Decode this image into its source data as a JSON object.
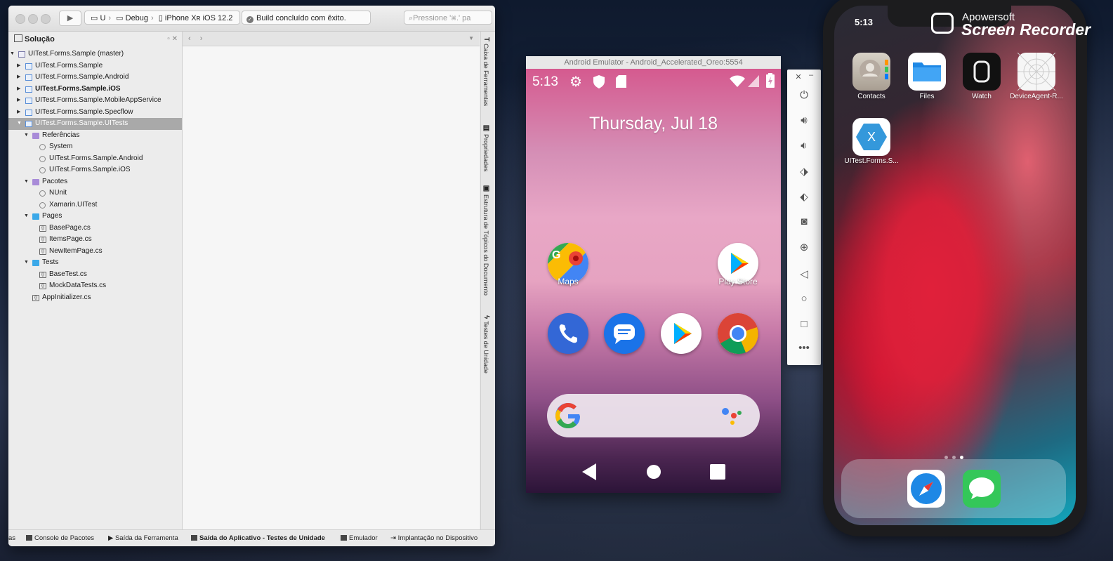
{
  "ide": {
    "scheme": {
      "project": "U",
      "config": "Debug",
      "device": "iPhone Xʀ iOS 12.2"
    },
    "build_status": "Build concluído com êxito.",
    "search_placeholder": "Pressione '⌘.' pa",
    "solution_title": "Solução",
    "tree": [
      {
        "label": "UITest.Forms.Sample (master)",
        "depth": 0,
        "icon": "sol",
        "arrow": "open"
      },
      {
        "label": "UITest.Forms.Sample",
        "depth": 1,
        "icon": "proj",
        "arrow": "closed"
      },
      {
        "label": "UITest.Forms.Sample.Android",
        "depth": 1,
        "icon": "proj",
        "arrow": "closed"
      },
      {
        "label": "UITest.Forms.Sample.iOS",
        "depth": 1,
        "icon": "proj",
        "arrow": "closed",
        "bold": true
      },
      {
        "label": "UITest.Forms.Sample.MobileAppService",
        "depth": 1,
        "icon": "proj",
        "arrow": "closed"
      },
      {
        "label": "UITest.Forms.Sample.Specflow",
        "depth": 1,
        "icon": "proj",
        "arrow": "closed"
      },
      {
        "label": "UITest.Forms.Sample.UITests",
        "depth": 1,
        "icon": "proj",
        "arrow": "open",
        "selected": true
      },
      {
        "label": "Referências",
        "depth": 2,
        "icon": "refs",
        "arrow": "open"
      },
      {
        "label": "System",
        "depth": 3,
        "icon": "ref"
      },
      {
        "label": "UITest.Forms.Sample.Android",
        "depth": 3,
        "icon": "ref"
      },
      {
        "label": "UITest.Forms.Sample.iOS",
        "depth": 3,
        "icon": "ref"
      },
      {
        "label": "Pacotes",
        "depth": 2,
        "icon": "refs",
        "arrow": "open"
      },
      {
        "label": "NUnit",
        "depth": 3,
        "icon": "ref"
      },
      {
        "label": "Xamarin.UITest",
        "depth": 3,
        "icon": "ref"
      },
      {
        "label": "Pages",
        "depth": 2,
        "icon": "folder",
        "arrow": "open"
      },
      {
        "label": "BasePage.cs",
        "depth": 3,
        "icon": "cs"
      },
      {
        "label": "ItemsPage.cs",
        "depth": 3,
        "icon": "cs"
      },
      {
        "label": "NewItemPage.cs",
        "depth": 3,
        "icon": "cs"
      },
      {
        "label": "Tests",
        "depth": 2,
        "icon": "folder",
        "arrow": "open"
      },
      {
        "label": "BaseTest.cs",
        "depth": 3,
        "icon": "cs"
      },
      {
        "label": "MockDataTests.cs",
        "depth": 3,
        "icon": "cs"
      },
      {
        "label": "AppInitializer.cs",
        "depth": 2,
        "icon": "cs"
      }
    ],
    "right_tabs": [
      "Caixa de Ferramentas",
      "Propriedades",
      "Estrutura de Tópicos do Documento",
      "Testes de Unidade"
    ],
    "bottom_tabs": [
      "as",
      "Console de Pacotes",
      "Saída da Ferramenta",
      "Saída do Aplicativo - Testes de Unidade",
      "Emulador",
      "Implantação no Dispositivo"
    ]
  },
  "android": {
    "window_title": "Android Emulator - Android_Accelerated_Oreo:5554",
    "time": "5:13",
    "date": "Thursday, Jul 18",
    "apps": {
      "maps": "Maps",
      "play_store": "Play Store"
    },
    "colors": {
      "phone": "#3367d6",
      "messages": "#1a73e8"
    }
  },
  "ios": {
    "time": "5:13",
    "apps": [
      "Contacts",
      "Files",
      "Watch",
      "DeviceAgent-R...",
      "UITest.Forms.S..."
    ]
  },
  "watermark": {
    "line1": "Apowersoft",
    "line2": "Screen Recorder"
  }
}
